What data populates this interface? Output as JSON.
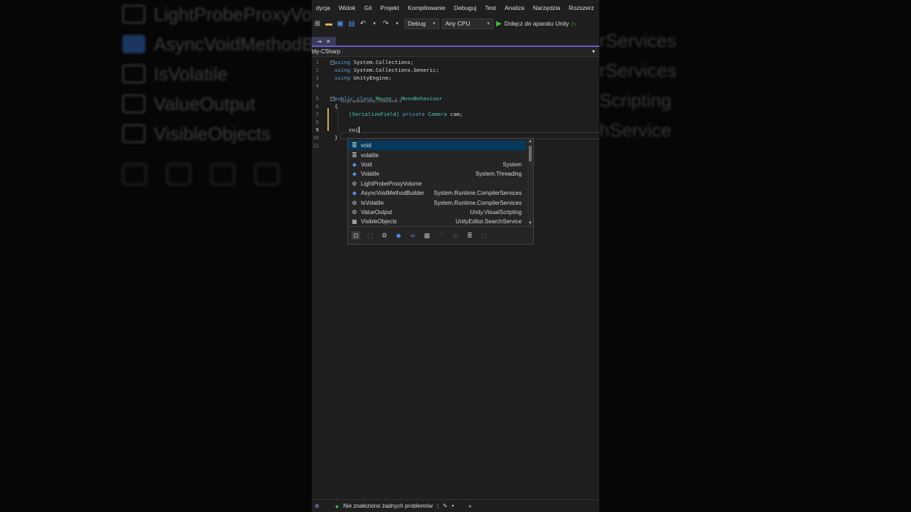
{
  "background": {
    "left_items": [
      {
        "label": "LightProbeProxyVolume",
        "icon": "component-icon"
      },
      {
        "label": "AsyncVoidMethodBuilder",
        "icon": "class-icon"
      },
      {
        "label": "IsVolatile",
        "icon": "component-icon"
      },
      {
        "label": "ValueOutput",
        "icon": "component-icon"
      },
      {
        "label": "VisibleObjects",
        "icon": "component-icon"
      }
    ],
    "right_items": [
      "rServices",
      "rServices",
      "Scripting",
      "hService"
    ]
  },
  "menubar": {
    "items": [
      "dycja",
      "Widok",
      "Git",
      "Projekt",
      "Kompilowanie",
      "Debuguj",
      "Test",
      "Analiza",
      "Narzędzia",
      "Rozszerz"
    ]
  },
  "toolbar": {
    "configuration": "Debug",
    "platform": "Any CPU",
    "run_label": "Dołącz do aparatu Unity"
  },
  "tabs": {
    "close_glyph": "✕",
    "pin_glyph": "⇥"
  },
  "navbar": {
    "project": "bly-CSharp",
    "dropdown_glyph": "▾"
  },
  "editor": {
    "line_numbers": [
      "1",
      "2",
      "3",
      "4",
      "5",
      "6",
      "7",
      "8",
      "9",
      "10",
      "11"
    ],
    "current_line": "9",
    "codelens": "Skrypt aparatu Unity | Odwołania: 0",
    "lines": [
      {
        "kw": "using",
        "rest": " System.Collections;"
      },
      {
        "kw": "using",
        "rest": " System.Collections.Generic;"
      },
      {
        "kw": "using",
        "rest": " UnityEngine;"
      },
      {
        "kw": "",
        "rest": ""
      },
      {
        "kw": "public class",
        "rest": " Mouse",
        "sep": " : ",
        "type": "MonoBehaviour"
      },
      {
        "kw": "",
        "rest": "{"
      },
      {
        "attr": "[SerializeField]",
        "kw": " private",
        "type": " Camera",
        "rest": " cam;"
      },
      {
        "kw": "",
        "rest": ""
      },
      {
        "kw": "",
        "rest": "voi"
      },
      {
        "kw": "",
        "rest": "}"
      },
      {
        "kw": "",
        "rest": ""
      }
    ]
  },
  "completion": {
    "items": [
      {
        "label": "void",
        "namespace": "",
        "icon": "keyword-icon",
        "selected": true
      },
      {
        "label": "volatile",
        "namespace": "",
        "icon": "keyword-icon",
        "selected": false
      },
      {
        "label": "Void",
        "namespace": "System",
        "icon": "class-icon",
        "selected": false
      },
      {
        "label": "Volatile",
        "namespace": "System.Threading",
        "icon": "class-icon",
        "selected": false
      },
      {
        "label": "LightProbeProxyVolume",
        "namespace": "",
        "icon": "component-icon",
        "selected": false
      },
      {
        "label": "AsyncVoidMethodBuilder",
        "namespace": "System.Runtime.CompilerServices",
        "icon": "class-icon",
        "selected": false
      },
      {
        "label": "IsVolatile",
        "namespace": "System.Runtime.CompilerServices",
        "icon": "component-icon",
        "selected": false
      },
      {
        "label": "ValueOutput",
        "namespace": "Unity.VisualScripting",
        "icon": "component-icon",
        "selected": false
      },
      {
        "label": "VisibleObjects",
        "namespace": "UnityEditor.SearchService",
        "icon": "struct-icon",
        "selected": false
      }
    ],
    "filters": [
      "snippets-filter-icon",
      "namespace-filter-icon",
      "component-filter-icon",
      "class-filter-icon",
      "interface-filter-icon",
      "struct-filter-icon",
      "enum-filter-icon",
      "delegate-filter-icon",
      "keyword-filter-icon",
      "module-filter-icon"
    ]
  },
  "statusbar": {
    "status": "Nie znaleziono żadnych problemów"
  },
  "colors": {
    "accent": "#6a5acd",
    "selection": "#04395e",
    "keyword": "#569cd6",
    "type": "#4ec9b0",
    "success": "#3fbf3f"
  }
}
